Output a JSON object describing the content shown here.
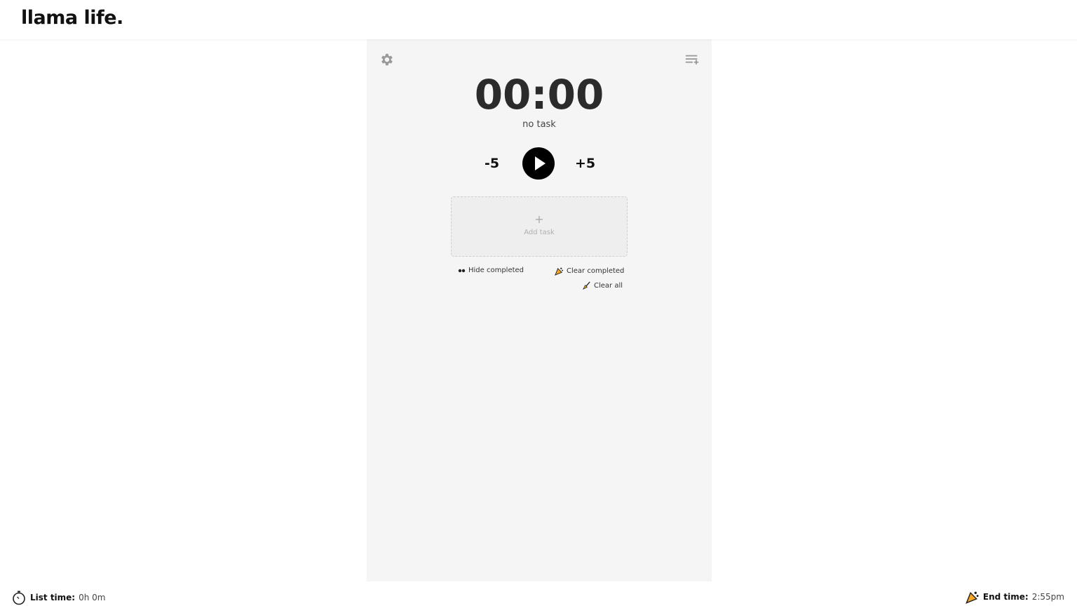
{
  "header": {
    "logo": "llama life."
  },
  "timer": {
    "display": "00:00",
    "task_name": "no task",
    "minus_label": "-5",
    "plus_label": "+5"
  },
  "add_task": {
    "plus": "+",
    "label": "Add task"
  },
  "actions": {
    "hide_completed": "Hide completed",
    "clear_completed": "Clear completed",
    "clear_all": "Clear all"
  },
  "footer": {
    "list_time_label": "List time:",
    "list_time_value": "0h 0m",
    "end_time_label": "End time:",
    "end_time_value": "2:55pm"
  },
  "colors": {
    "panel_bg": "#f5f5f5",
    "play_button": "#000000",
    "text_dark": "#2b2b2b"
  },
  "icons": {
    "settings": "gear-icon",
    "menu": "playlist-add-icon",
    "play": "play-icon",
    "hide": "eyes-icon",
    "clear_completed": "party-popper-icon",
    "clear_all": "broom-icon",
    "list_time": "stopwatch-icon",
    "end_time": "party-popper-icon"
  }
}
